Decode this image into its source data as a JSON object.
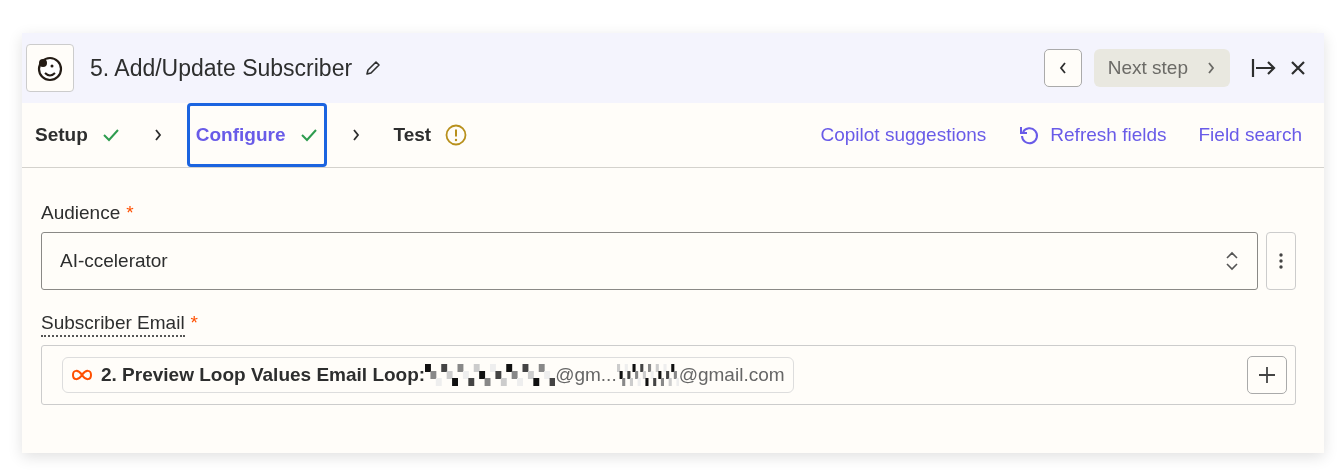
{
  "header": {
    "title": "5. Add/Update Subscriber",
    "next_button": "Next step"
  },
  "steps": [
    {
      "label": "Setup",
      "complete": true,
      "warning": false,
      "selected": false
    },
    {
      "label": "Configure",
      "complete": true,
      "warning": false,
      "selected": true
    },
    {
      "label": "Test",
      "complete": false,
      "warning": true,
      "selected": false
    }
  ],
  "actions": [
    {
      "label": "Copilot suggestions",
      "kind": "link"
    },
    {
      "label": "Refresh fields",
      "kind": "refresh"
    },
    {
      "label": "Field search",
      "kind": "link"
    }
  ],
  "fields": [
    {
      "label": "Audience",
      "required_mark": "*",
      "kind": "select",
      "value": "AI-ccelerator"
    },
    {
      "label": "Subscriber Email",
      "required_mark": "*",
      "kind": "mapped",
      "pill": {
        "source": "2. Preview Loop Values Email Loop:",
        "parts": [
          "@gm...",
          "@gmail.com"
        ]
      }
    }
  ]
}
